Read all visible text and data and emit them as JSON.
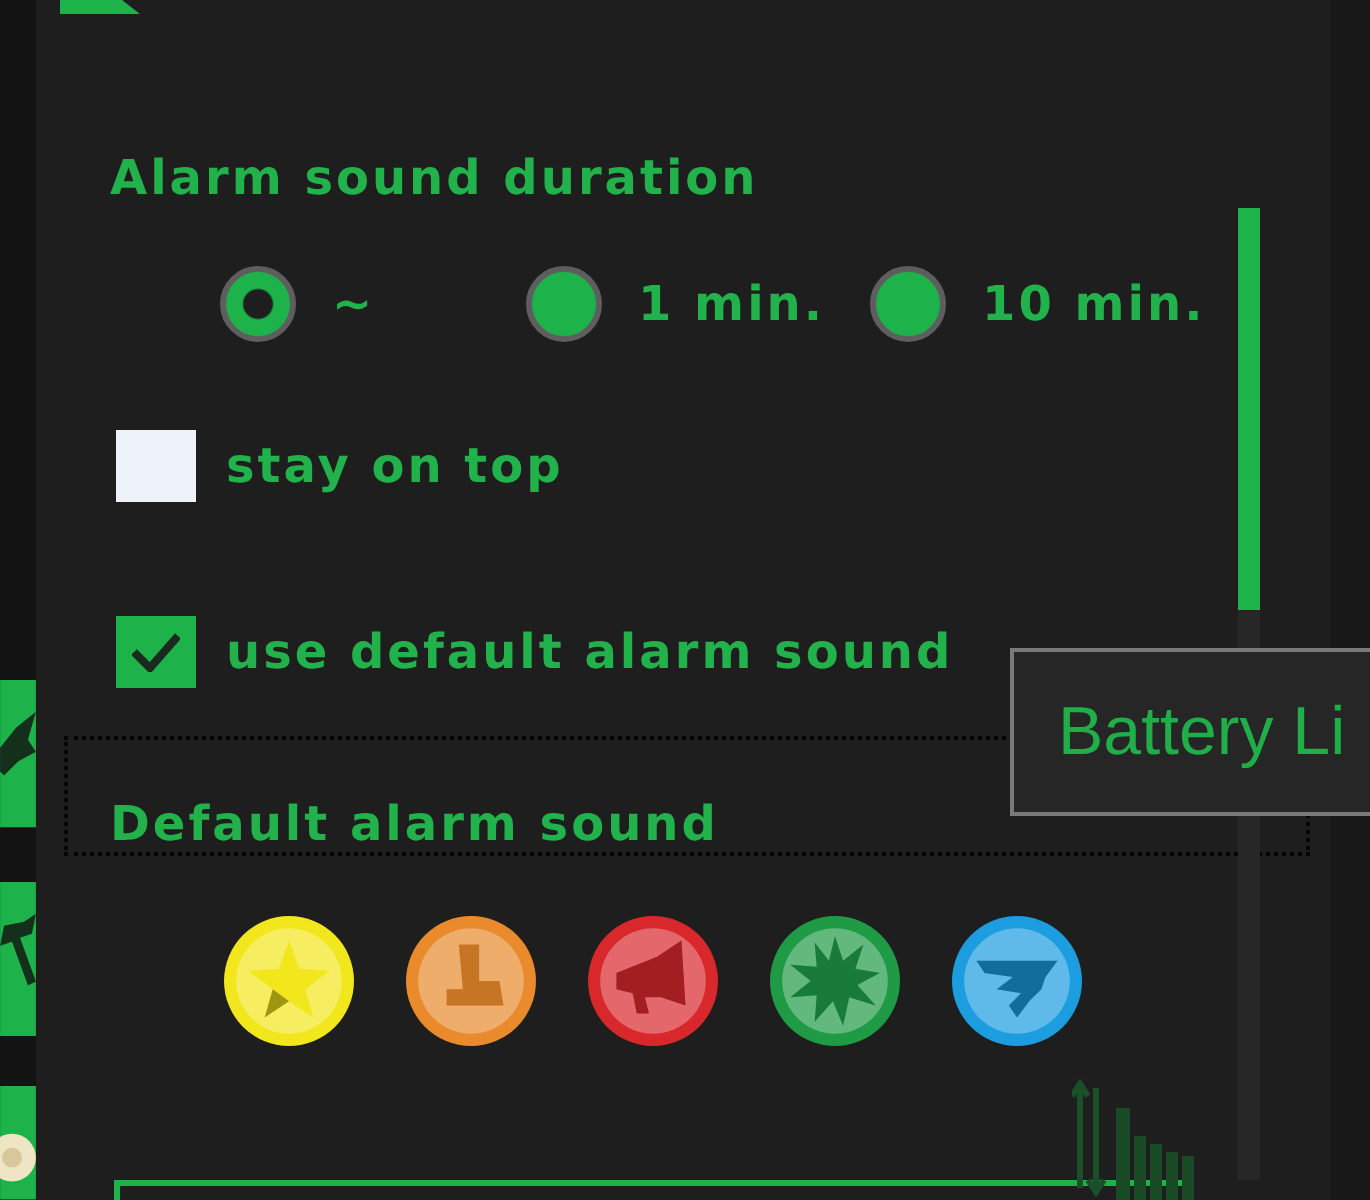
{
  "duration": {
    "title": "Alarm sound duration",
    "options": [
      {
        "label": "~",
        "selected": true
      },
      {
        "label": "1 min.",
        "selected": false
      },
      {
        "label": "10 min.",
        "selected": false
      }
    ]
  },
  "options": [
    {
      "label": "stay on top",
      "checked": false
    },
    {
      "label": "use default alarm sound",
      "checked": true
    }
  ],
  "default_sound": {
    "title": "Default alarm sound",
    "focused": true,
    "sounds": [
      {
        "color": "#f2e61c"
      },
      {
        "color": "#e98a2c"
      },
      {
        "color": "#d8282c"
      },
      {
        "color": "#1f9a45"
      },
      {
        "color": "#1c9de0"
      }
    ]
  },
  "tooltip": {
    "text": "Battery Li"
  }
}
